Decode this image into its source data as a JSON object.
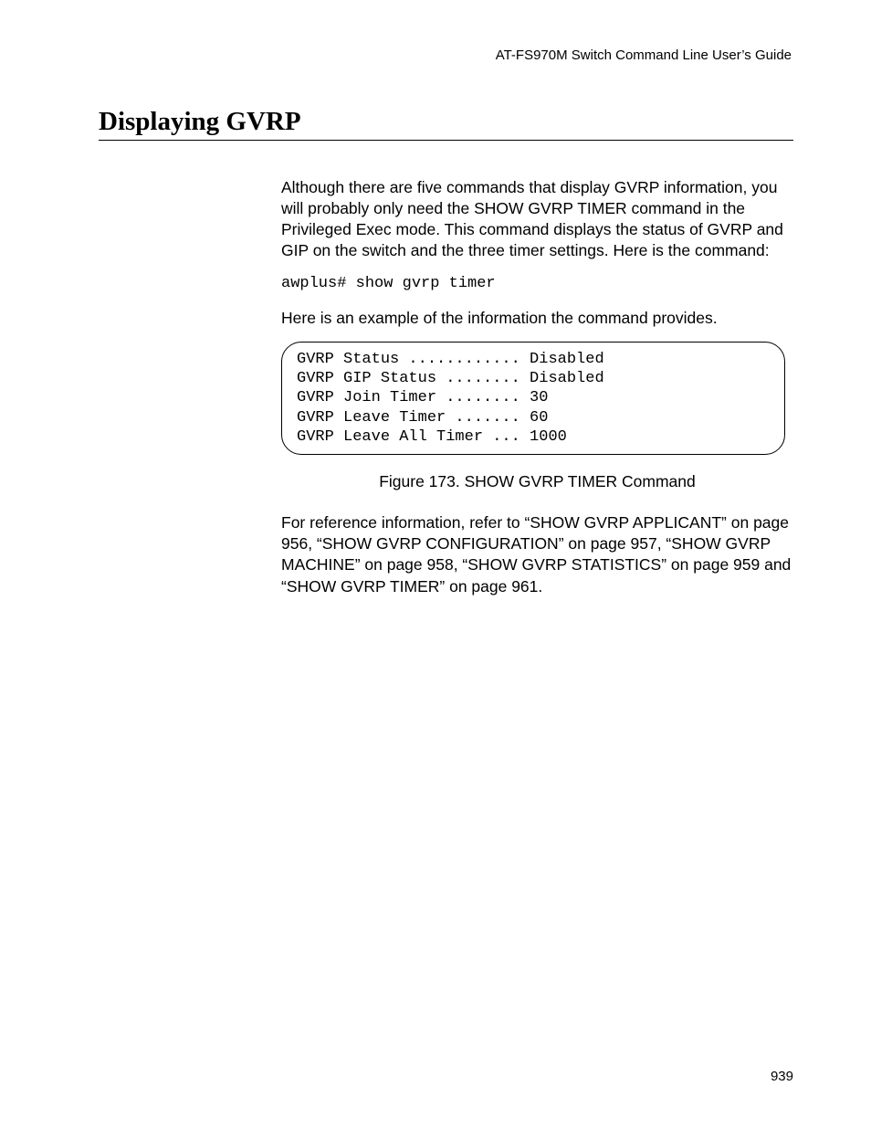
{
  "header": {
    "running": "AT-FS970M Switch Command Line User’s Guide"
  },
  "section": {
    "title": "Displaying GVRP"
  },
  "body": {
    "p1": "Although there are five commands that display GVRP information, you will probably only need the SHOW GVRP TIMER command in the Privileged Exec mode. This command displays the status of GVRP and GIP on the switch and the three timer settings. Here is the command:",
    "cmd": "awplus# show gvrp timer",
    "p2": "Here is an example of the information the command provides.",
    "output": "GVRP Status ............ Disabled\nGVRP GIP Status ........ Disabled\nGVRP Join Timer ........ 30\nGVRP Leave Timer ....... 60\nGVRP Leave All Timer ... 1000",
    "figcap": "Figure 173. SHOW GVRP TIMER Command",
    "p3": "For reference information, refer to “SHOW GVRP APPLICANT” on page 956, “SHOW GVRP CONFIGURATION” on page 957, “SHOW GVRP MACHINE” on page 958, “SHOW GVRP STATISTICS” on page 959 and “SHOW GVRP TIMER” on page 961."
  },
  "footer": {
    "page_number": "939"
  }
}
